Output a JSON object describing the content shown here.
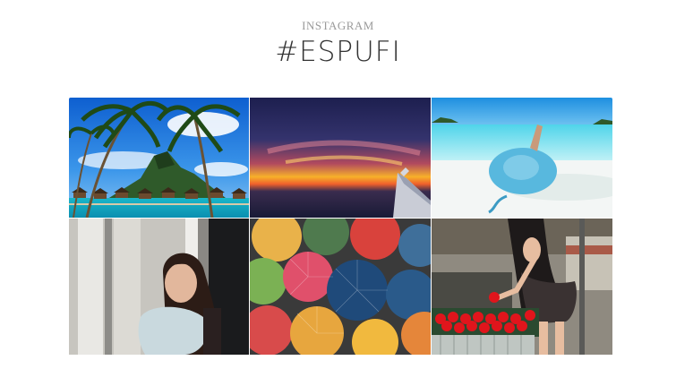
{
  "section": {
    "eyebrow": "INSTAGRAM",
    "title": "#ESPUFI"
  },
  "photos": [
    {
      "subject": "palm trees and overwater bungalows on a tropical island"
    },
    {
      "subject": "sunset seen from an airplane window"
    },
    {
      "subject": "woman in blue sun hat on white beach"
    },
    {
      "subject": "smiling woman hugging a pillow by a window"
    },
    {
      "subject": "colorful open umbrellas overhead"
    },
    {
      "subject": "woman buying tomatoes at a market stall"
    }
  ]
}
